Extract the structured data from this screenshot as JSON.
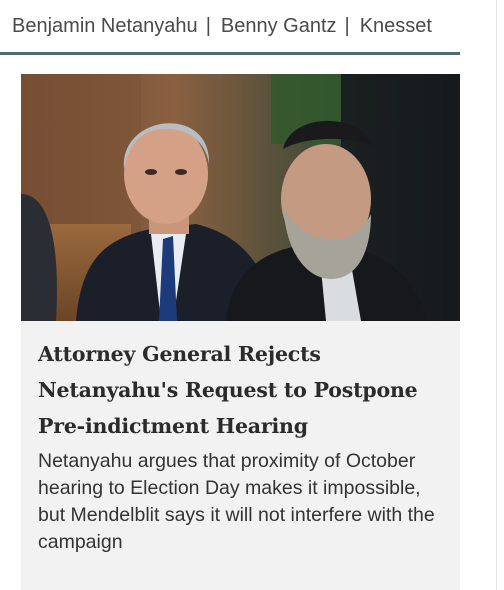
{
  "tags": {
    "items": [
      "Benjamin Netanyahu",
      "Benny Gantz",
      "Knesset"
    ],
    "separator": "|"
  },
  "article": {
    "headline": "Attorney General Rejects Netanyahu's Request to Postpone Pre-indictment Hearing",
    "summary": "Netanyahu argues that proximity of October hearing to Election Day makes it impossible, but Mendelblit says it will not interfere with the campaign",
    "image": "photo of two men seated at a meeting table"
  },
  "colors": {
    "rule": "#4d6b73",
    "card_background": "#f2f2f2",
    "headline": "#2b2b2b",
    "body_text": "#333333",
    "tag_text": "#4a4a4a"
  }
}
